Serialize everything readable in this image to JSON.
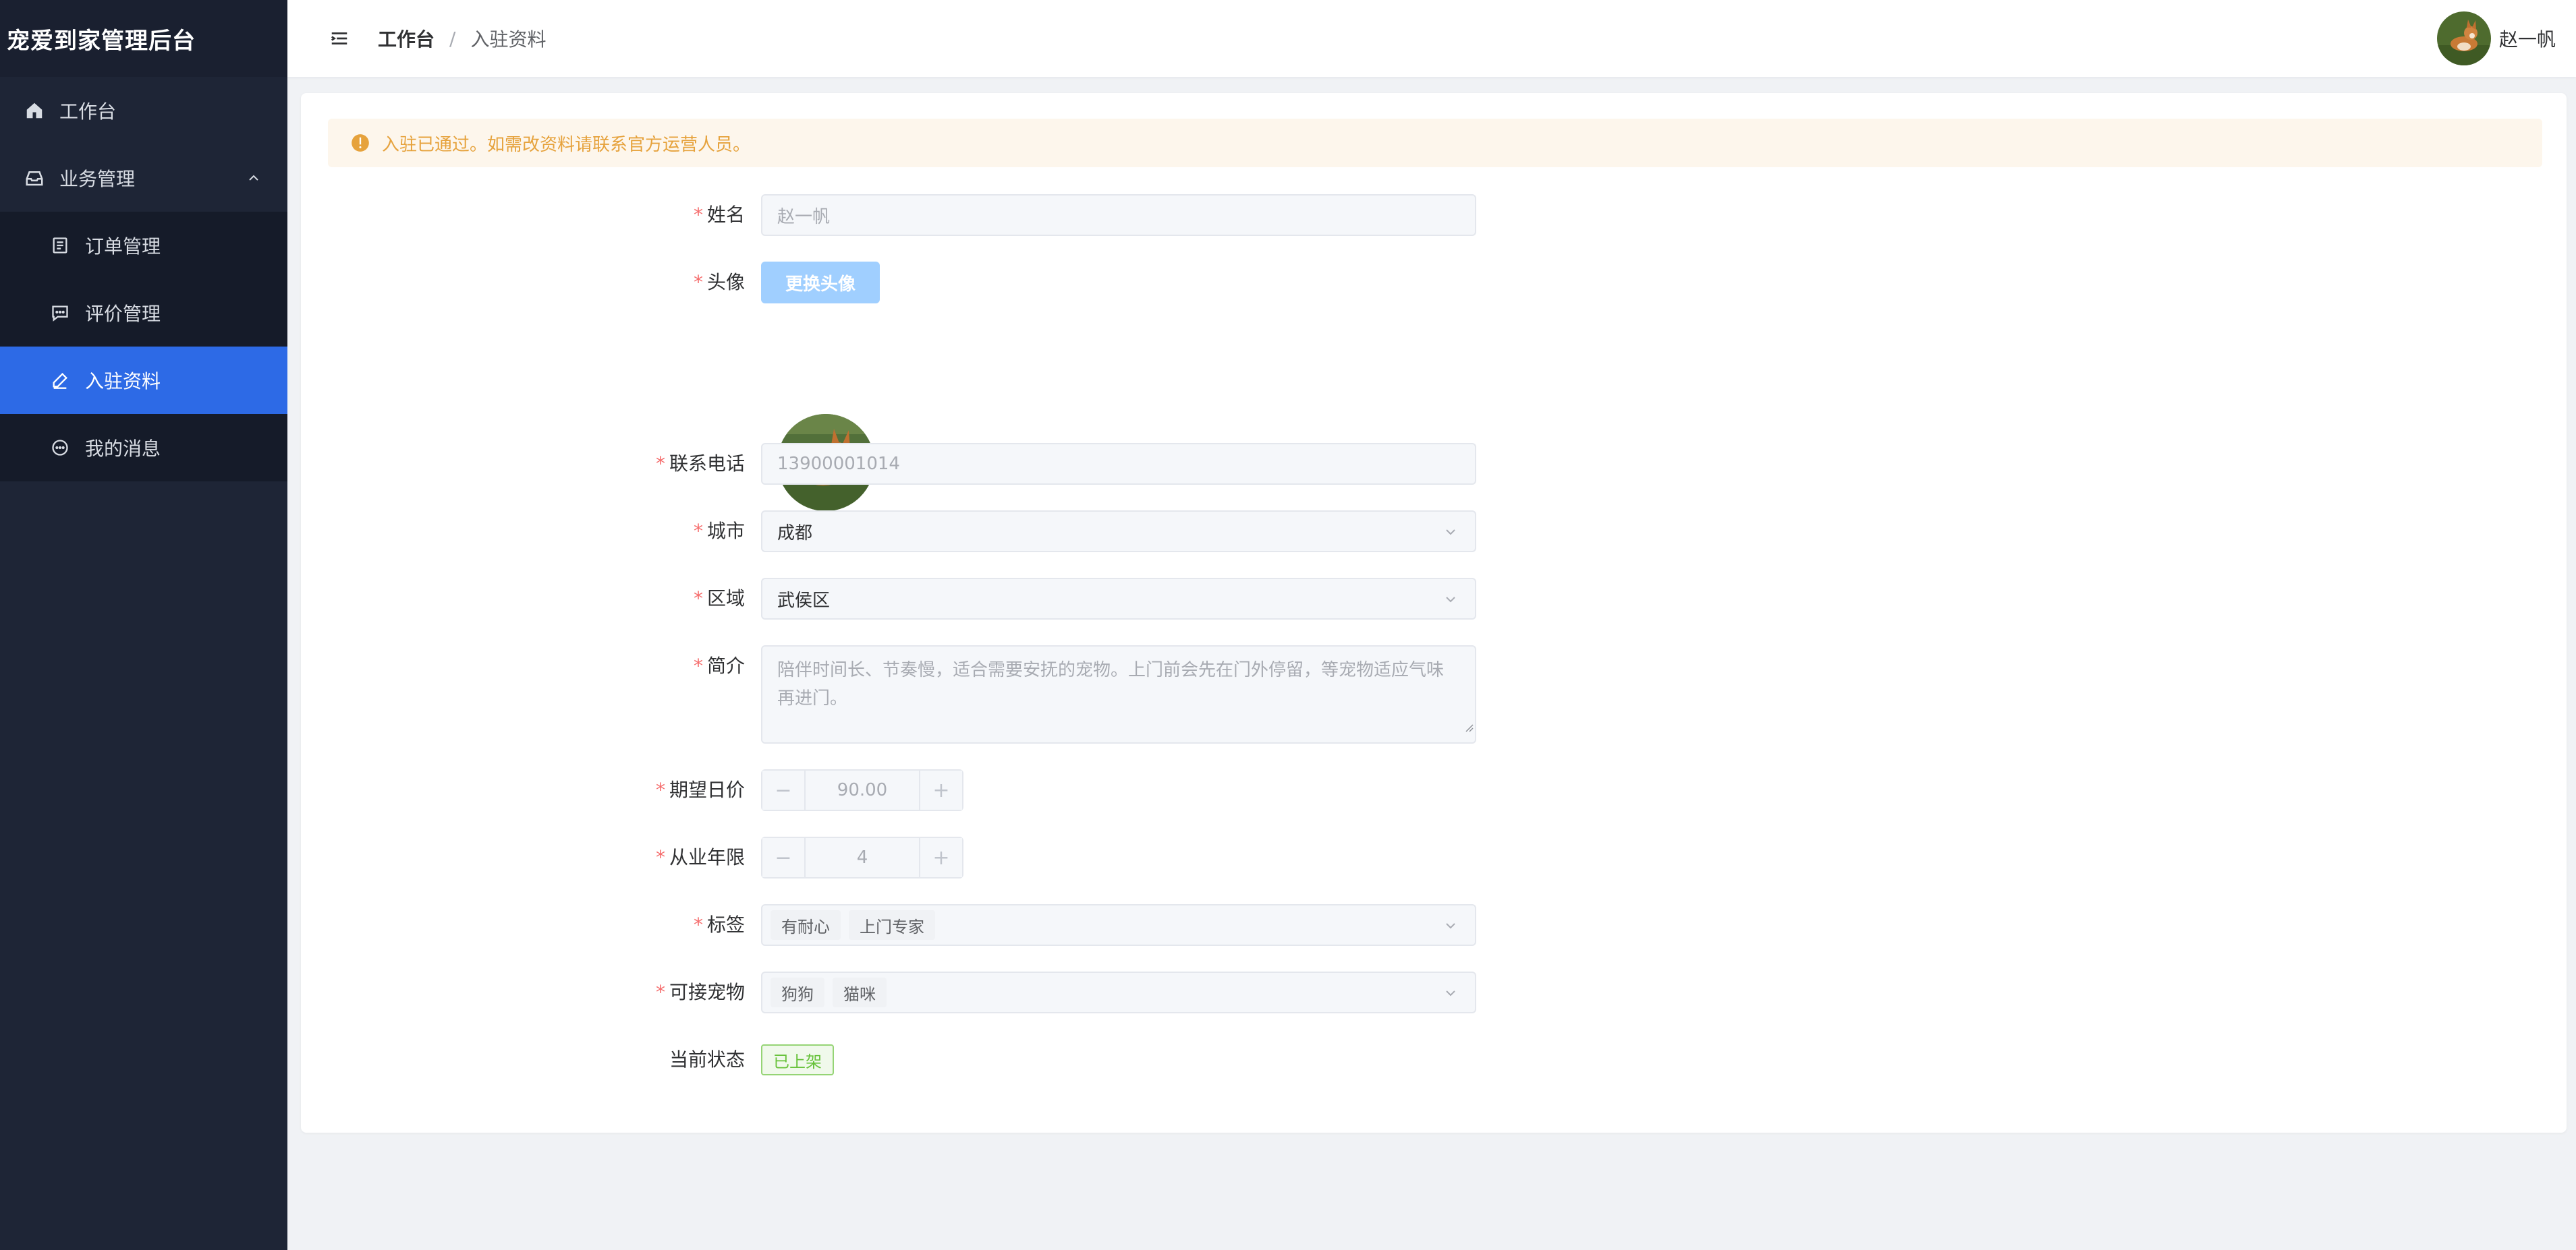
{
  "app": {
    "title": "宠爱到家管理后台"
  },
  "sidebar": {
    "items": [
      {
        "label": "工作台",
        "icon": "home-icon"
      },
      {
        "label": "业务管理",
        "icon": "box-icon",
        "expanded": true
      },
      {
        "label": "订单管理",
        "icon": "document-icon"
      },
      {
        "label": "评价管理",
        "icon": "comment-icon"
      },
      {
        "label": "入驻资料",
        "icon": "edit-icon",
        "active": true
      },
      {
        "label": "我的消息",
        "icon": "chat-icon"
      }
    ]
  },
  "header": {
    "breadcrumb": {
      "home": "工作台",
      "separator": "/",
      "current": "入驻资料"
    },
    "user": {
      "name": "赵一帆"
    }
  },
  "alert": {
    "text": "入驻已通过。如需改资料请联系官方运营人员。",
    "color": "#e6a23c"
  },
  "form": {
    "name": {
      "label": "姓名",
      "value": "赵一帆"
    },
    "avatar": {
      "label": "头像",
      "button": "更换头像"
    },
    "phone": {
      "label": "联系电话",
      "value": "13900001014"
    },
    "city": {
      "label": "城市",
      "value": "成都"
    },
    "district": {
      "label": "区域",
      "value": "武侯区"
    },
    "intro": {
      "label": "简介",
      "value": "陪伴时间长、节奏慢，适合需要安抚的宠物。上门前会先在门外停留，等宠物适应气味再进门。"
    },
    "daily_price": {
      "label": "期望日价",
      "value": "90.00",
      "minus": "−",
      "plus": "+"
    },
    "years": {
      "label": "从业年限",
      "value": "4",
      "minus": "−",
      "plus": "+"
    },
    "tags": {
      "label": "标签",
      "values": [
        "有耐心",
        "上门专家"
      ]
    },
    "pets": {
      "label": "可接宠物",
      "values": [
        "狗狗",
        "猫咪"
      ]
    },
    "status": {
      "label": "当前状态",
      "value": "已上架",
      "color": "#67c23a"
    },
    "required_mark": "*"
  },
  "colors": {
    "sidebar_bg": "#1e2536",
    "active": "#2d6ae6",
    "primary_light": "#a0cfff"
  }
}
